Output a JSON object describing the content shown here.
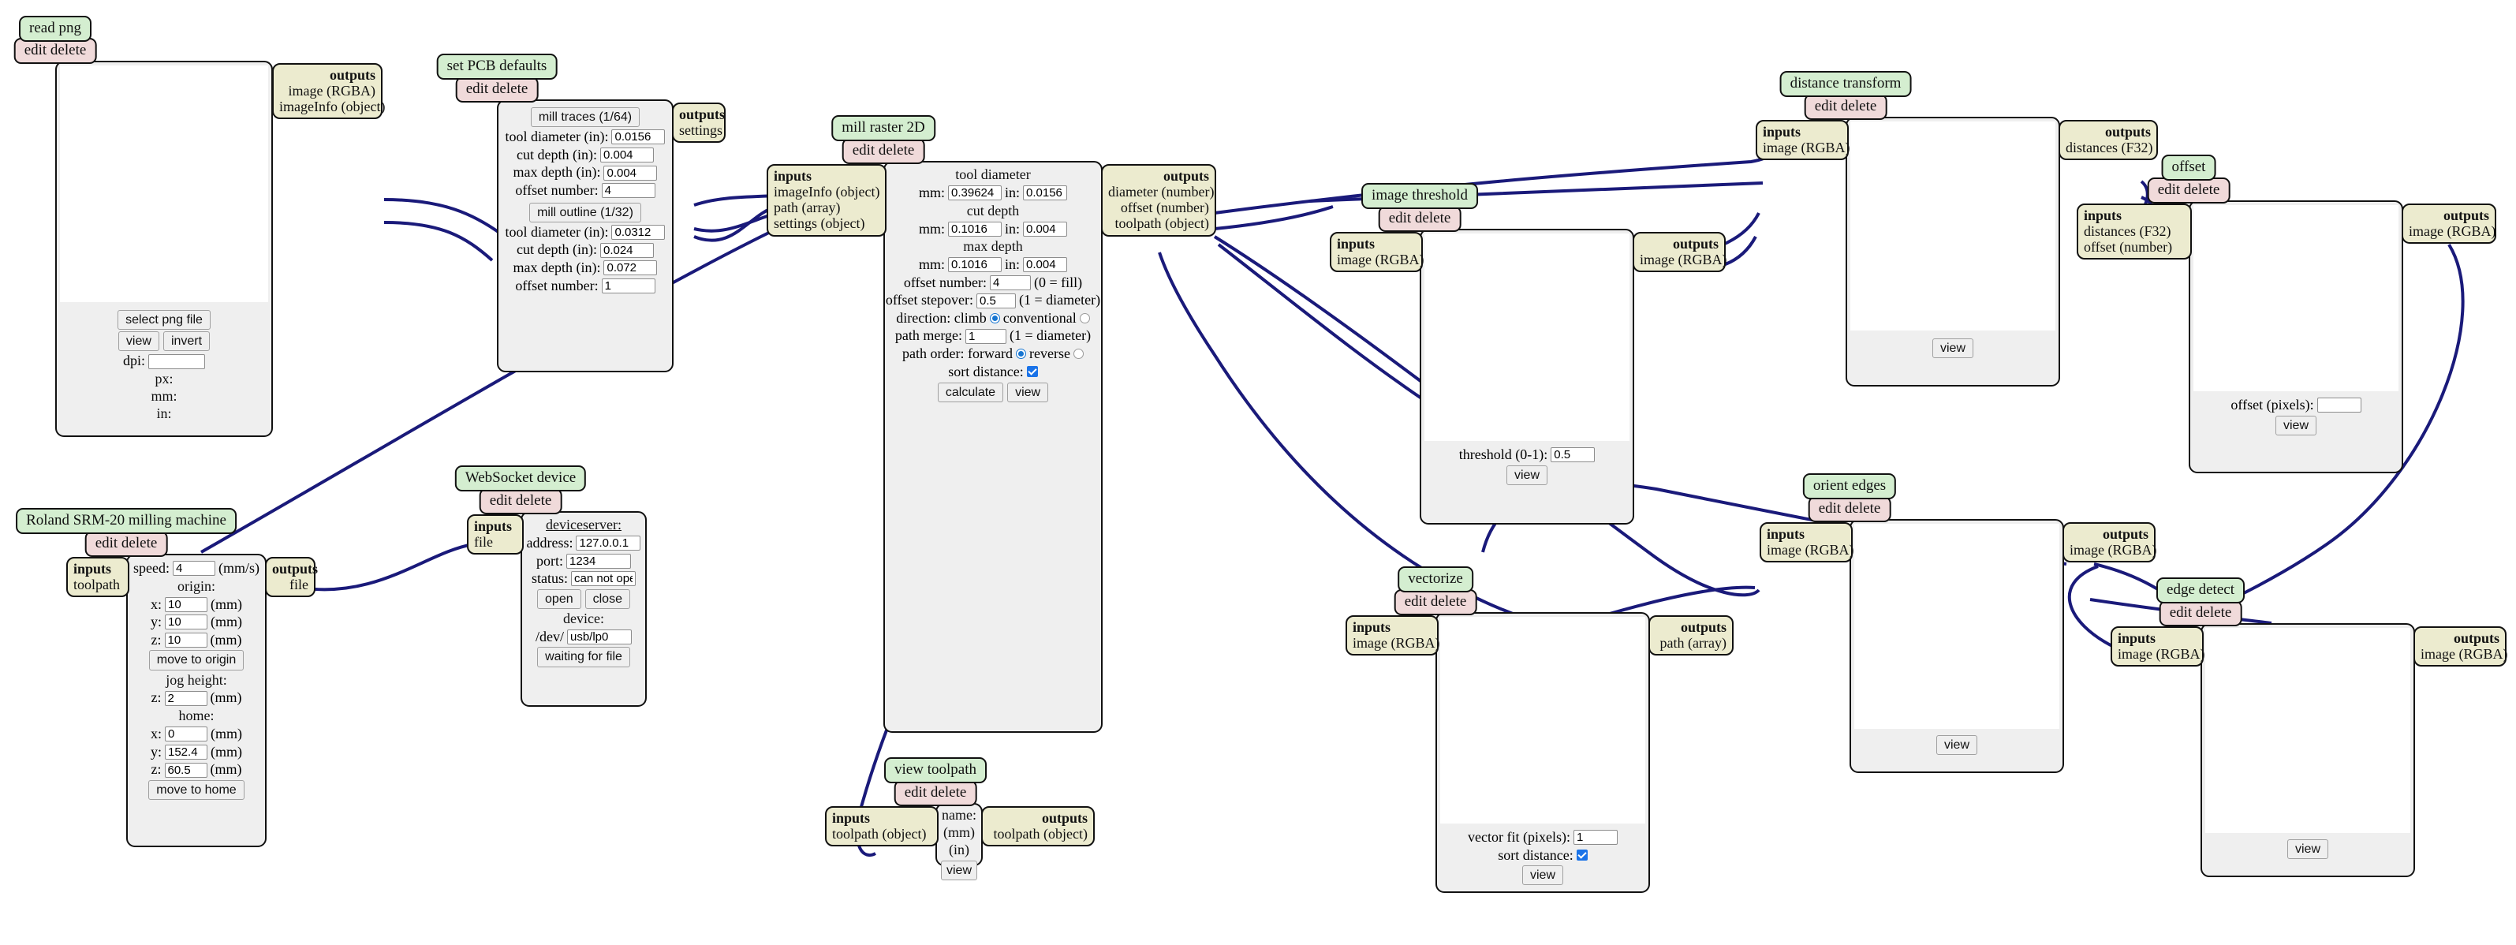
{
  "theme": {
    "title_bg": "#d4eed0",
    "editdelete_bg": "#f0dada",
    "io_bg": "#ecebcf",
    "body_bg": "#efefef",
    "wire": "#1a1a7a",
    "accent": "#1a73e8"
  },
  "common": {
    "edit_delete": "edit delete",
    "inputs": "inputs",
    "outputs": "outputs",
    "view": "view",
    "mm_unit": "(mm)"
  },
  "nodes": {
    "read_png": {
      "title": "read png",
      "edit_delete": "edit delete",
      "outputs_label": "outputs",
      "outputs": [
        "image (RGBA)",
        "imageInfo (object)"
      ],
      "select_button": "select png file",
      "view_button": "view",
      "invert_button": "invert",
      "dpi_label": "dpi:",
      "dpi_value": "",
      "px_label": "px:",
      "mm_label": "mm:",
      "in_label": "in:"
    },
    "set_pcb_defaults": {
      "title": "set PCB defaults",
      "edit_delete": "edit delete",
      "outputs_label": "outputs",
      "outputs": [
        "settings"
      ],
      "traces_button": "mill traces (1/64)",
      "traces": [
        {
          "label": "tool diameter (in):",
          "value": "0.0156"
        },
        {
          "label": "cut depth (in):",
          "value": "0.004"
        },
        {
          "label": "max depth (in):",
          "value": "0.004"
        },
        {
          "label": "offset number:",
          "value": "4"
        }
      ],
      "outline_button": "mill outline (1/32)",
      "outline": [
        {
          "label": "tool diameter (in):",
          "value": "0.0312"
        },
        {
          "label": "cut depth (in):",
          "value": "0.024"
        },
        {
          "label": "max depth (in):",
          "value": "0.072"
        },
        {
          "label": "offset number:",
          "value": "1"
        }
      ]
    },
    "mill_raster_2d": {
      "title": "mill raster 2D",
      "edit_delete": "edit delete",
      "inputs_label": "inputs",
      "inputs": [
        "imageInfo (object)",
        "path (array)",
        "settings (object)"
      ],
      "outputs_label": "outputs",
      "outputs": [
        "diameter (number)",
        "offset (number)",
        "toolpath (object)"
      ],
      "tool_diameter_label": "tool diameter",
      "tool_diameter_mm_label": "mm:",
      "tool_diameter_mm": "0.39624",
      "tool_diameter_in_label": "in:",
      "tool_diameter_in": "0.0156",
      "cut_depth_label": "cut depth",
      "cut_depth_mm_label": "mm:",
      "cut_depth_mm": "0.1016",
      "cut_depth_in_label": "in:",
      "cut_depth_in": "0.004",
      "max_depth_label": "max depth",
      "max_depth_mm_label": "mm:",
      "max_depth_mm": "0.1016",
      "max_depth_in_label": "in:",
      "max_depth_in": "0.004",
      "offset_number_label": "offset number:",
      "offset_number": "4",
      "offset_number_hint": "(0 = fill)",
      "offset_stepover_label": "offset stepover:",
      "offset_stepover": "0.5",
      "offset_stepover_hint": "(1 = diameter)",
      "direction_label": "direction: climb",
      "direction_climb_selected": true,
      "direction_conventional_label": "conventional",
      "direction_conventional_selected": false,
      "path_merge_label": "path merge:",
      "path_merge": "1",
      "path_merge_hint": "(1 = diameter)",
      "path_order_label": "path order: forward",
      "path_order_forward_selected": true,
      "path_order_reverse_label": "reverse",
      "path_order_reverse_selected": false,
      "sort_distance_label": "sort distance:",
      "sort_distance_checked": true,
      "calculate_button": "calculate",
      "view_button": "view"
    },
    "image_threshold": {
      "title": "image threshold",
      "edit_delete": "edit delete",
      "inputs_label": "inputs",
      "inputs": [
        "image (RGBA)"
      ],
      "outputs_label": "outputs",
      "outputs": [
        "image (RGBA)"
      ],
      "threshold_label": "threshold (0-1):",
      "threshold_value": "0.5",
      "view_button": "view"
    },
    "distance_transform": {
      "title": "distance transform",
      "edit_delete": "edit delete",
      "inputs_label": "inputs",
      "inputs": [
        "image (RGBA)"
      ],
      "outputs_label": "outputs",
      "outputs": [
        "distances (F32)"
      ],
      "view_button": "view"
    },
    "offset": {
      "title": "offset",
      "edit_delete": "edit delete",
      "inputs_label": "inputs",
      "inputs": [
        "distances (F32)",
        "offset (number)"
      ],
      "outputs_label": "outputs",
      "outputs": [
        "image (RGBA)"
      ],
      "offset_pixels_label": "offset (pixels):",
      "offset_pixels_value": "",
      "view_button": "view"
    },
    "orient_edges": {
      "title": "orient edges",
      "edit_delete": "edit delete",
      "inputs_label": "inputs",
      "inputs": [
        "image (RGBA)"
      ],
      "outputs_label": "outputs",
      "outputs": [
        "image (RGBA)"
      ],
      "view_button": "view"
    },
    "edge_detect": {
      "title": "edge detect",
      "edit_delete": "edit delete",
      "inputs_label": "inputs",
      "inputs": [
        "image (RGBA)"
      ],
      "outputs_label": "outputs",
      "outputs": [
        "image (RGBA)"
      ],
      "view_button": "view"
    },
    "vectorize": {
      "title": "vectorize",
      "edit_delete": "edit delete",
      "inputs_label": "inputs",
      "inputs": [
        "image (RGBA)"
      ],
      "outputs_label": "outputs",
      "outputs": [
        "path (array)"
      ],
      "vector_fit_label": "vector fit (pixels):",
      "vector_fit_value": "1",
      "sort_distance_label": "sort distance:",
      "sort_distance_checked": true,
      "view_button": "view"
    },
    "roland_srm20": {
      "title": "Roland SRM-20 milling machine",
      "edit_delete": "edit delete",
      "inputs_label": "inputs",
      "inputs": [
        "toolpath"
      ],
      "outputs_label": "outputs",
      "outputs": [
        "file"
      ],
      "speed_label": "speed:",
      "speed_value": "4",
      "speed_unit": "(mm/s)",
      "origin_label": "origin:",
      "origin": [
        {
          "axis": "x:",
          "value": "10",
          "unit": "(mm)"
        },
        {
          "axis": "y:",
          "value": "10",
          "unit": "(mm)"
        },
        {
          "axis": "z:",
          "value": "10",
          "unit": "(mm)"
        }
      ],
      "move_to_origin_button": "move to origin",
      "jog_height_label": "jog height:",
      "jog_axis": "z:",
      "jog_value": "2",
      "jog_unit": "(mm)",
      "home_label": "home:",
      "home": [
        {
          "axis": "x:",
          "value": "0",
          "unit": "(mm)"
        },
        {
          "axis": "y:",
          "value": "152.4",
          "unit": "(mm)"
        },
        {
          "axis": "z:",
          "value": "60.5",
          "unit": "(mm)"
        }
      ],
      "move_to_home_button": "move to home"
    },
    "websocket_device": {
      "title": "WebSocket device",
      "edit_delete": "edit delete",
      "inputs_label": "inputs",
      "inputs": [
        "file"
      ],
      "deviceserver_label": "deviceserver:",
      "address_label": "address:",
      "address_value": "127.0.0.1",
      "port_label": "port:",
      "port_value": "1234",
      "status_label": "status:",
      "status_value": "can not open",
      "open_button": "open",
      "close_button": "close",
      "device_label": "device:",
      "device_prefix": "/dev/",
      "device_value": "usb/lp0",
      "waiting_button": "waiting for file"
    },
    "view_toolpath": {
      "title": "view toolpath",
      "edit_delete": "edit delete",
      "inputs_label": "inputs",
      "inputs": [
        "toolpath (object)"
      ],
      "outputs_label": "outputs",
      "outputs": [
        "toolpath (object)"
      ],
      "name_label": "name:",
      "mm_label": "(mm)",
      "in_label": "(in)",
      "view_button": "view"
    }
  }
}
